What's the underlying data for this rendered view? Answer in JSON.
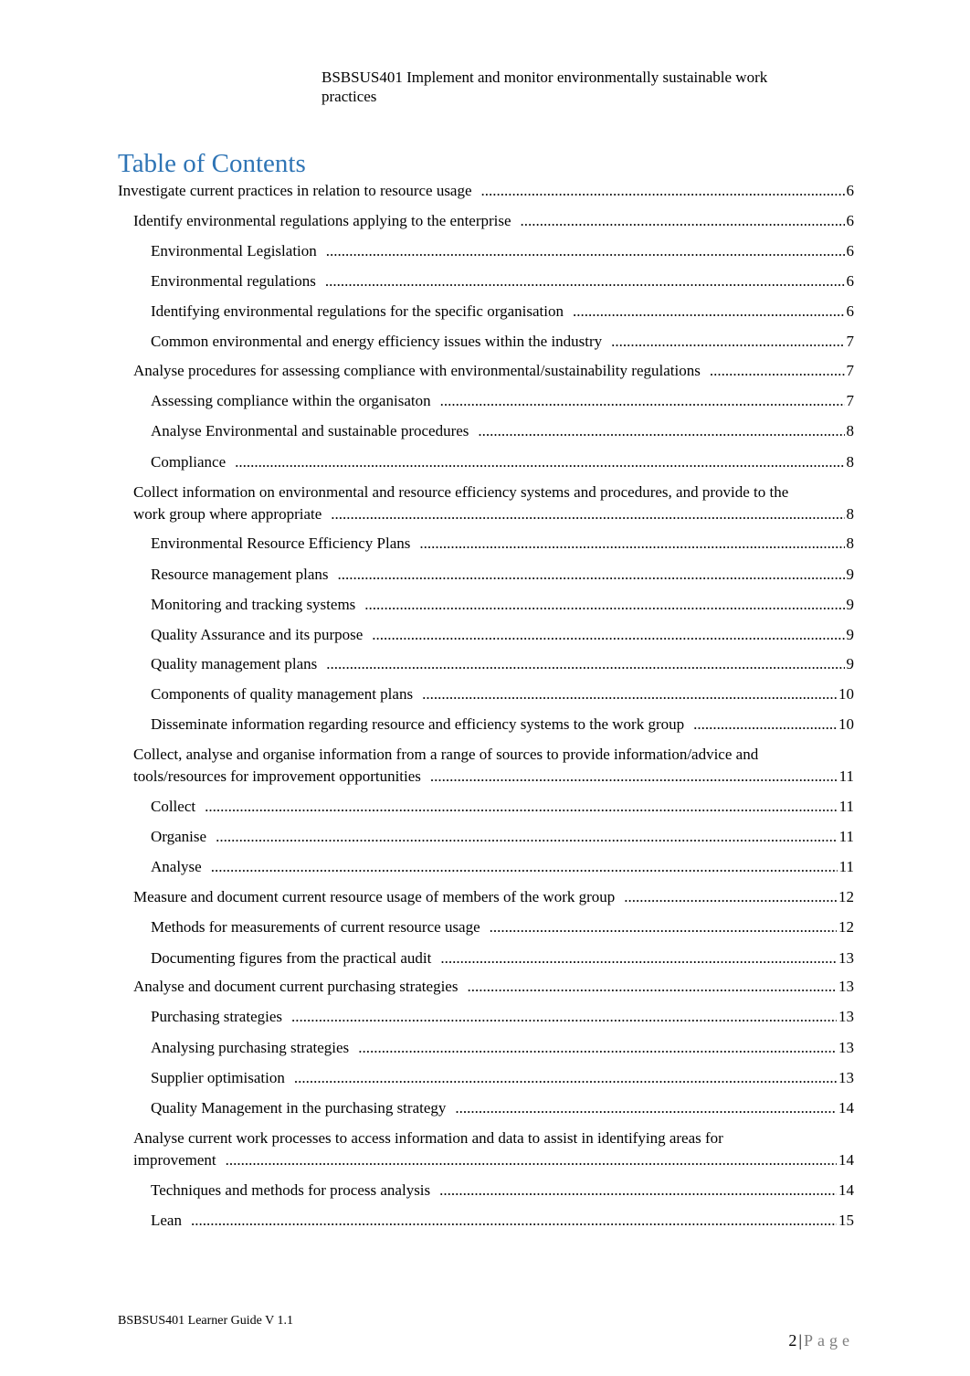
{
  "header": {
    "title": "BSBSUS401 Implement and monitor environmentally sustainable work practices"
  },
  "toc": {
    "title": "Table of Contents",
    "title_color": "#2e74b5",
    "entries": [
      {
        "level": 1,
        "text": "Investigate current practices in relation to resource usage",
        "page": "6"
      },
      {
        "level": 2,
        "text": "Identify environmental regulations applying to the enterprise",
        "page": "6"
      },
      {
        "level": 3,
        "text": "Environmental Legislation",
        "page": "6"
      },
      {
        "level": 3,
        "text": "Environmental regulations",
        "page": "6"
      },
      {
        "level": 3,
        "text": "Identifying environmental regulations for the specific organisation",
        "page": "6"
      },
      {
        "level": 3,
        "text": "Common environmental and energy efficiency issues within the industry",
        "page": "7"
      },
      {
        "level": 2,
        "text": "Analyse procedures for assessing compliance with environmental/sustainability regulations",
        "page": "7"
      },
      {
        "level": 3,
        "text": "Assessing compliance within the organisaton",
        "page": "7"
      },
      {
        "level": 3,
        "text": "Analyse Environmental and sustainable procedures",
        "page": "8"
      },
      {
        "level": 3,
        "text": "Compliance",
        "page": "8"
      },
      {
        "level": 2,
        "text_line1": "Collect information on environmental and resource efficiency systems and procedures, and provide to the",
        "text": "work group where appropriate",
        "page": "8"
      },
      {
        "level": 3,
        "text": "Environmental Resource Efficiency Plans",
        "page": "8"
      },
      {
        "level": 3,
        "text": "Resource management plans",
        "page": "9"
      },
      {
        "level": 3,
        "text": "Monitoring and tracking systems",
        "page": "9"
      },
      {
        "level": 3,
        "text": "Quality Assurance and its purpose",
        "page": "9"
      },
      {
        "level": 3,
        "text": "Quality management plans",
        "page": "9"
      },
      {
        "level": 3,
        "text": "Components of quality management plans",
        "page": "10"
      },
      {
        "level": 3,
        "text": "Disseminate information regarding resource and efficiency systems to the work group",
        "page": "10"
      },
      {
        "level": 2,
        "text_line1": "Collect, analyse and organise information from a range of sources to provide information/advice and",
        "text": "tools/resources for improvement opportunities",
        "page": "11"
      },
      {
        "level": 3,
        "text": "Collect",
        "page": "11"
      },
      {
        "level": 3,
        "text": "Organise",
        "page": "11"
      },
      {
        "level": 3,
        "text": "Analyse",
        "page": "11"
      },
      {
        "level": 2,
        "text": "Measure and document current resource usage of members of the work group",
        "page": "12"
      },
      {
        "level": 3,
        "text": "Methods for measurements of current resource usage",
        "page": "12"
      },
      {
        "level": 3,
        "text": "Documenting figures from the practical audit",
        "page": "13"
      },
      {
        "level": 2,
        "text": "Analyse and document current purchasing strategies",
        "page": "13"
      },
      {
        "level": 3,
        "text": "Purchasing strategies",
        "page": "13"
      },
      {
        "level": 3,
        "text": "Analysing purchasing strategies",
        "page": "13"
      },
      {
        "level": 3,
        "text": "Supplier optimisation",
        "page": "13"
      },
      {
        "level": 3,
        "text": "Quality Management in the purchasing strategy",
        "page": "14"
      },
      {
        "level": 2,
        "text_line1": "Analyse current work processes to access information and data to assist in identifying areas for",
        "text": "improvement",
        "page": "14"
      },
      {
        "level": 3,
        "text": "Techniques and methods for process analysis",
        "page": "14"
      },
      {
        "level": 3,
        "text": "Lean",
        "page": "15"
      }
    ]
  },
  "footer": {
    "left": "BSBSUS401 Learner Guide V 1.1",
    "page_number": "2",
    "separator": "|",
    "page_word": "Page"
  }
}
